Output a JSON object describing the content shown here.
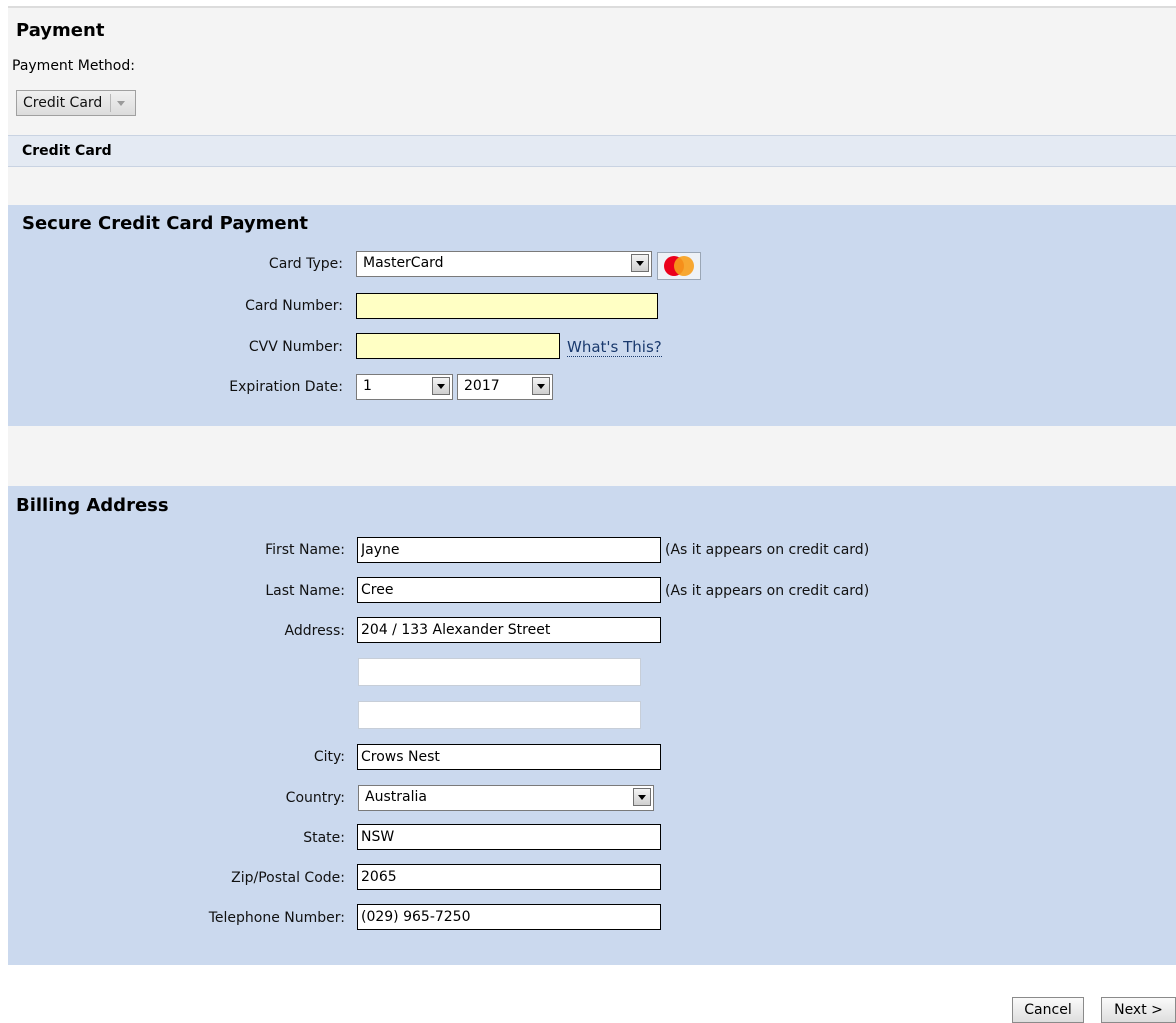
{
  "payment": {
    "title": "Payment",
    "method_label": "Payment Method:",
    "method_value": "Credit Card"
  },
  "credit_card_strip": {
    "label": "Credit Card"
  },
  "secure": {
    "title": "Secure Credit Card Payment",
    "card_type_label": "Card Type:",
    "card_type_value": "MasterCard",
    "card_logo_icon": "mastercard-icon",
    "card_number_label": "Card Number:",
    "card_number_value": "",
    "cvv_label": "CVV Number:",
    "cvv_value": "",
    "whats_this": "What's This?",
    "expiration_label": "Expiration Date:",
    "exp_month": "1",
    "exp_year": "2017"
  },
  "billing": {
    "title": "Billing Address",
    "first_name_label": "First Name:",
    "first_name": "Jayne",
    "first_name_note": "(As it appears on credit card)",
    "last_name_label": "Last Name:",
    "last_name": "Cree",
    "last_name_note": "(As it appears on credit card)",
    "address_label": "Address:",
    "address1": "204 / 133 Alexander Street",
    "address2": "",
    "address3": "",
    "city_label": "City:",
    "city": "Crows Nest",
    "country_label": "Country:",
    "country": "Australia",
    "state_label": "State:",
    "state": "NSW",
    "zip_label": "Zip/Postal Code:",
    "zip": "2065",
    "phone_label": "Telephone Number:",
    "phone": "(029) 965-7250"
  },
  "actions": {
    "cancel": "Cancel",
    "next": "Next >"
  },
  "colors": {
    "panel_blue": "#cbd9ee",
    "panel_grey": "#f4f4f4",
    "required_field": "#ffffc4",
    "mastercard_red": "#eb001b",
    "mastercard_orange": "#f79e1b"
  }
}
